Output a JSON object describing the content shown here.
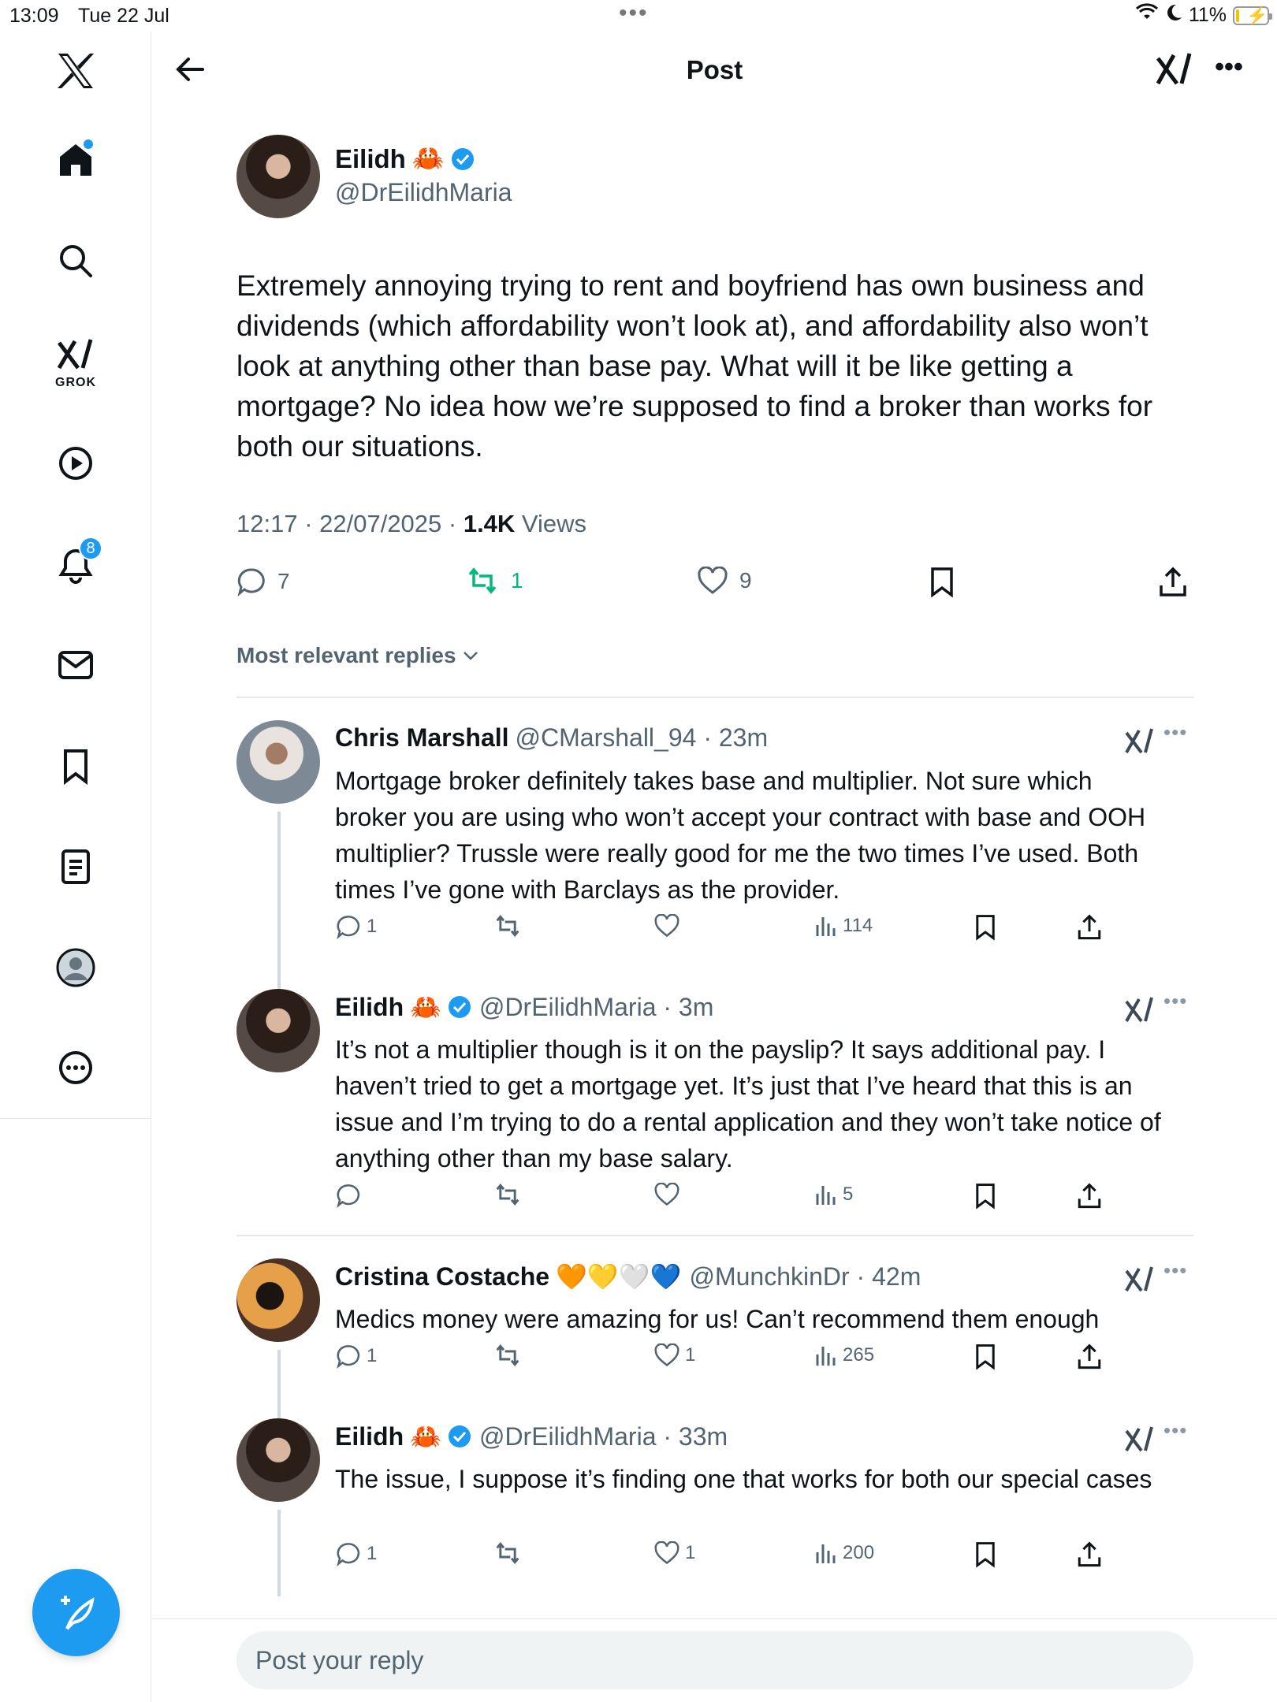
{
  "status_bar": {
    "time": "13:09",
    "date": "Tue 22 Jul",
    "battery": "11%",
    "battery_level": 0.11
  },
  "header": {
    "title": "Post"
  },
  "sidebar": {
    "grok_label": "GROK",
    "notifications_count": "8"
  },
  "post": {
    "author_name": "Eilidh",
    "author_emoji": "🦀",
    "author_handle": "@DrEilidhMaria",
    "text": "Extremely annoying trying to rent and boyfriend has own business and dividends (which affordability won’t look at), and affordability also won’t look at anything other than base pay. What will it be like getting a mortgage? No idea how we’re supposed to find a broker than works for both our situations.",
    "timestamp": "12:17 · 22/07/2025 · ",
    "views_count": "1.4K",
    "views_label": " Views",
    "replies": "7",
    "reposts": "1",
    "likes": "9"
  },
  "sort_label": "Most relevant replies",
  "replies": [
    {
      "name": "Chris Marshall",
      "emoji": "",
      "handle": "@CMarshall_94 · 23m",
      "text": "Mortgage broker definitely takes base and multiplier. Not sure which broker you are using who won’t accept your contract with base and OOH multiplier? Trussle were really good for me the two times I’ve used. Both times I’ve gone with Barclays as the provider.",
      "reply_count": "1",
      "like_count": "",
      "views": "114"
    },
    {
      "name": "Eilidh",
      "emoji": "🦀",
      "handle": "@DrEilidhMaria · 3m",
      "text": "It’s not a multiplier though is it on the payslip? It says additional pay. I haven’t tried to get a mortgage yet. It’s just that I’ve heard that this is an issue and I’m trying to do a rental application and they won’t take notice of  anything other than my base salary.",
      "reply_count": "",
      "like_count": "",
      "views": "5"
    },
    {
      "name": "Cristina Costache",
      "emoji": "🧡💛🤍💙",
      "handle": "@MunchkinDr · 42m",
      "text": "Medics money were amazing for us! Can’t recommend them enough",
      "reply_count": "1",
      "like_count": "1",
      "views": "265"
    },
    {
      "name": "Eilidh",
      "emoji": "🦀",
      "handle": "@DrEilidhMaria · 33m",
      "text": "The issue, I suppose it’s finding one that works for both our special cases",
      "reply_count": "1",
      "like_count": "1",
      "views": "200"
    }
  ],
  "reply_bar": {
    "placeholder": "Post your reply"
  },
  "colors": {
    "accent": "#1d9bf0",
    "repost_active": "#00ba7c",
    "text": "#0f1419",
    "muted": "#536471"
  }
}
